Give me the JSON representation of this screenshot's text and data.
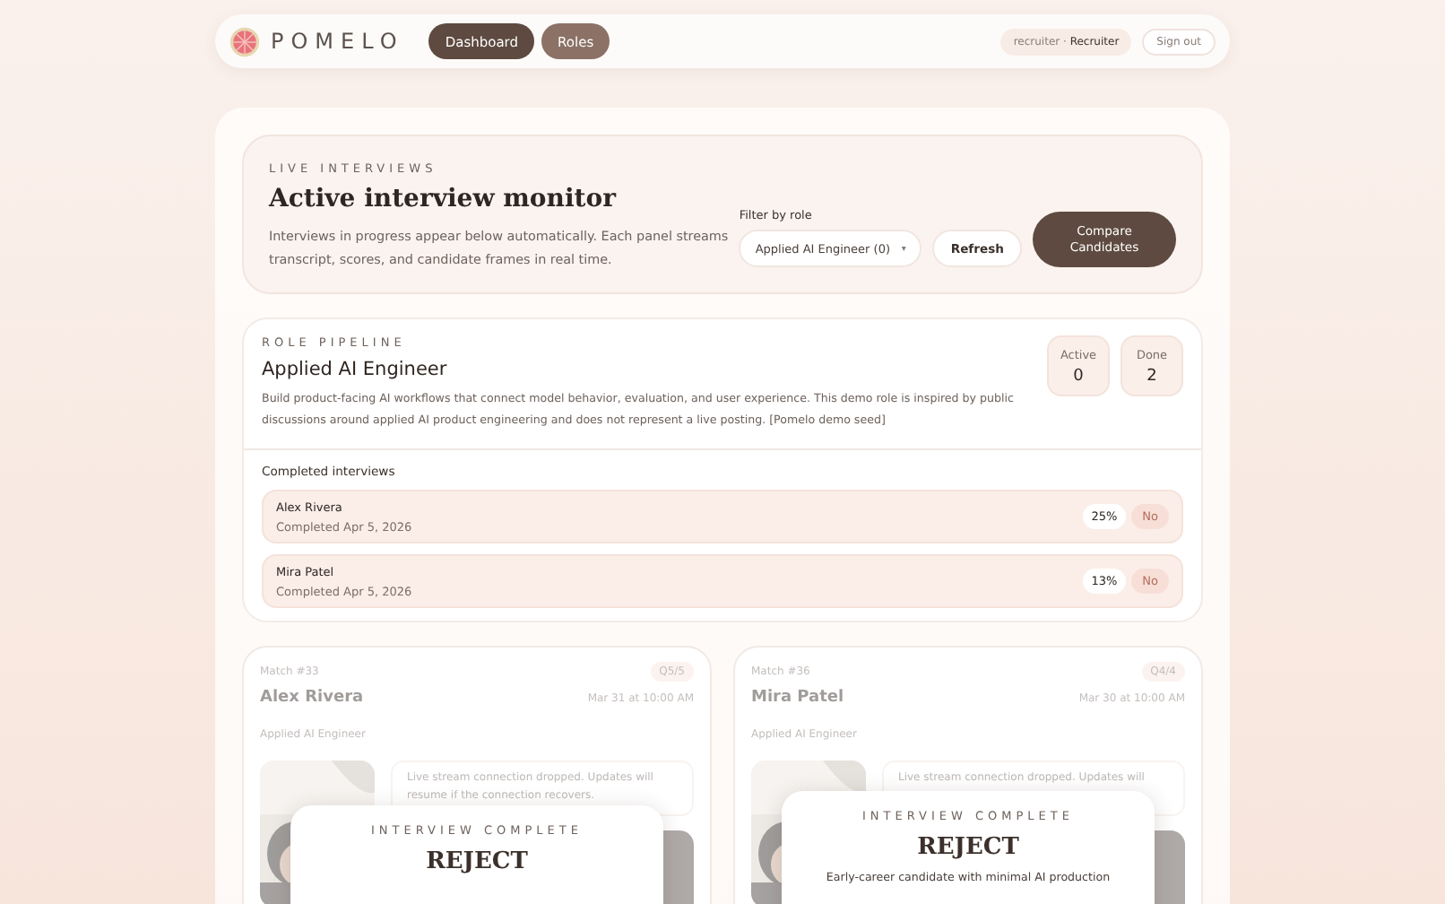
{
  "brand": {
    "name": "POMELO"
  },
  "nav": [
    {
      "label": "Dashboard",
      "selected": true
    },
    {
      "label": "Roles",
      "selected": false
    }
  ],
  "user": {
    "handle": "recruiter",
    "separator": "·",
    "role": "Recruiter"
  },
  "sign_out": "Sign out",
  "monitor": {
    "eyebrow": "LIVE INTERVIEWS",
    "title": "Active interview monitor",
    "description": "Interviews in progress appear below automatically. Each panel streams transcript, scores, and candidate frames in real time.",
    "filter_label": "Filter by role",
    "filter_value": "Applied AI Engineer (0)",
    "caret": "▾",
    "refresh": "Refresh",
    "compare": "Compare Candidates"
  },
  "pipeline": {
    "eyebrow": "ROLE PIPELINE",
    "title": "Applied AI Engineer",
    "description": "Build product-facing AI workflows that connect model behavior, evaluation, and user experience. This demo role is inspired by public discussions around applied AI product engineering and does not represent a live posting. [Pomelo demo seed]",
    "stats": [
      {
        "label": "Active",
        "value": "0"
      },
      {
        "label": "Done",
        "value": "2"
      }
    ],
    "completed_heading": "Completed interviews",
    "completed": [
      {
        "name": "Alex Rivera",
        "date": "Completed Apr 5, 2026",
        "score": "25%",
        "decision": "No"
      },
      {
        "name": "Mira Patel",
        "date": "Completed Apr 5, 2026",
        "score": "13%",
        "decision": "No"
      }
    ]
  },
  "sessions": [
    {
      "match": "Match #33",
      "question": "Q5/5",
      "name": "Alex Rivera",
      "time": "Mar 31 at 10:00 AM",
      "role": "Applied AI Engineer",
      "notice": "Live stream connection dropped. Updates will resume if the connection recovers.",
      "overlay": {
        "eyebrow": "INTERVIEW COMPLETE",
        "verdict": "REJECT"
      }
    },
    {
      "match": "Match #36",
      "question": "Q4/4",
      "name": "Mira Patel",
      "time": "Mar 30 at 10:00 AM",
      "role": "Applied AI Engineer",
      "notice": "Live stream connection dropped. Updates will",
      "overlay": {
        "eyebrow": "INTERVIEW COMPLETE",
        "verdict": "REJECT",
        "summary": "Early-career candidate with minimal AI production"
      }
    }
  ]
}
